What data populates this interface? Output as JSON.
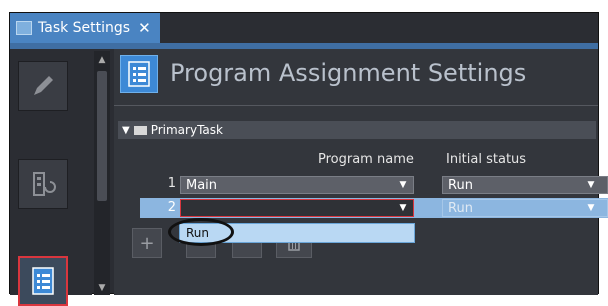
{
  "tab": {
    "title": "Task Settings",
    "close": "✕"
  },
  "page": {
    "title": "Program Assignment Settings"
  },
  "group": {
    "name": "PrimaryTask"
  },
  "columns": {
    "program_name": "Program name",
    "initial_status": "Initial status"
  },
  "rows": [
    {
      "num": "1",
      "program": "Main",
      "status": "Run"
    },
    {
      "num": "2",
      "program": "",
      "status": "Run"
    }
  ],
  "dropdown": {
    "option": "Run"
  },
  "toolbar": {
    "add": "+"
  },
  "colors": {
    "accent": "#4a84c2",
    "highlight": "#d9363e",
    "selected_row": "#8cb6e0"
  }
}
